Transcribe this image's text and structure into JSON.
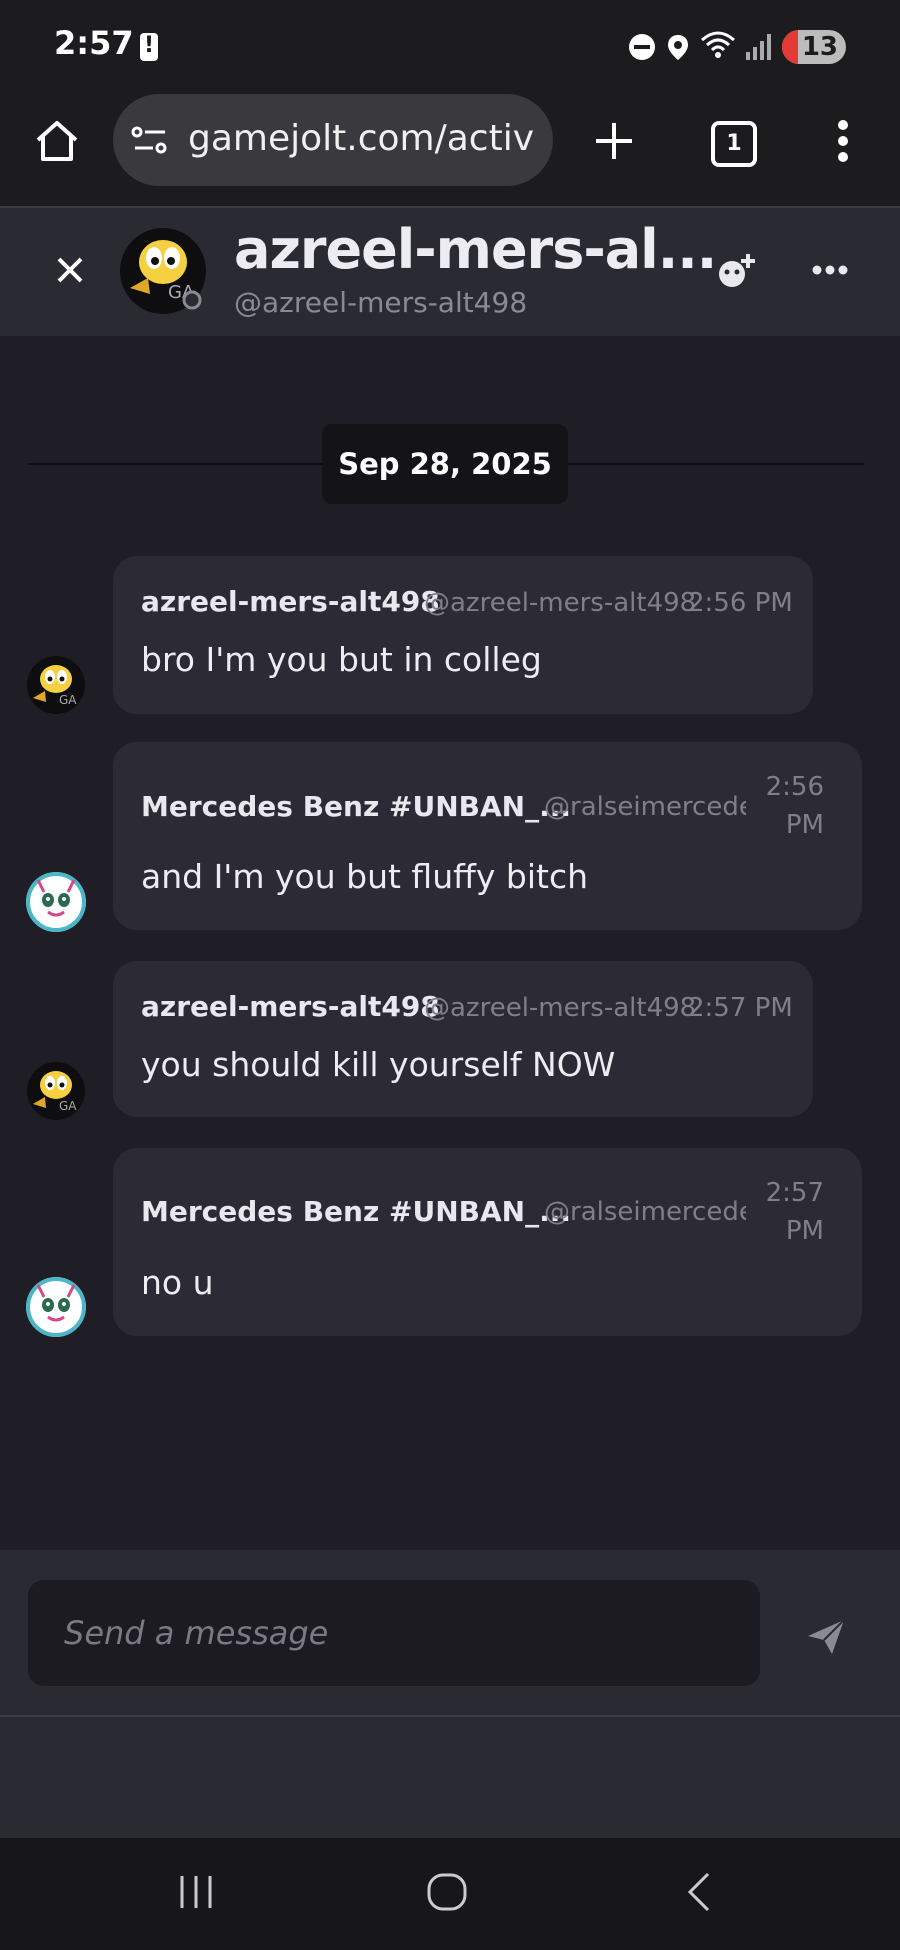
{
  "status_bar": {
    "time": "2:57",
    "battery_level": "13",
    "icons": [
      "battery-alert-icon",
      "do-not-disturb-icon",
      "location-icon",
      "wifi-icon",
      "signal-icon"
    ]
  },
  "browser": {
    "url": "gamejolt.com/activity",
    "tab_count": "1",
    "icons": [
      "home-icon",
      "site-settings-icon",
      "new-tab-icon",
      "tabs-icon",
      "menu-icon"
    ]
  },
  "chat_header": {
    "title": "azreel-mers-al...",
    "handle": "@azreel-mers-alt498"
  },
  "date_divider": "Sep 28, 2025",
  "messages": [
    {
      "name": "azreel-mers-alt498",
      "handle": "@azreel-mers-alt498",
      "time": "2:56 PM",
      "text": "bro I'm you but in colleg"
    },
    {
      "name": "Mercedes Benz #UNBAN_...",
      "handle": "@ralseimercede...",
      "time": "2:56 PM",
      "text": "and I'm you but fluffy bitch"
    },
    {
      "name": "azreel-mers-alt498",
      "handle": "@azreel-mers-alt498",
      "time": "2:57 PM",
      "text": "you should kill yourself NOW"
    },
    {
      "name": "Mercedes Benz #UNBAN_...",
      "handle": "@ralseimercede...",
      "time": "2:57 PM",
      "text": "no u"
    }
  ],
  "composer": {
    "placeholder": "Send a message"
  },
  "colors": {
    "background": "#1f1e26",
    "header": "#2a2a33",
    "bubble": "#2c2b35",
    "muted_text": "#7f7f8a"
  }
}
